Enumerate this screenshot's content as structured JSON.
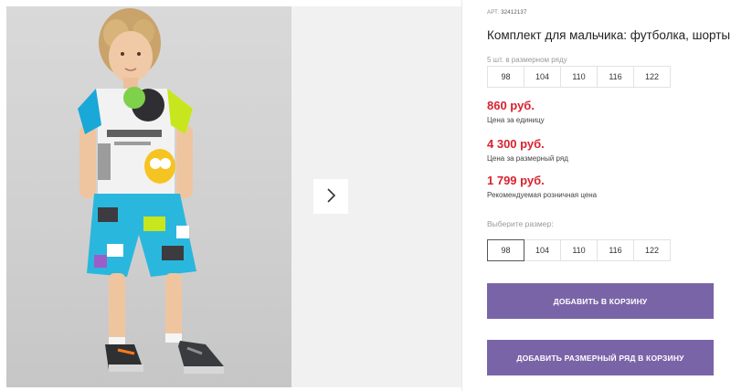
{
  "product": {
    "article_label": "АРТ.",
    "article_value": "32412137",
    "title": "Комплект для мальчика: футболка, шорты"
  },
  "pack": {
    "caption": "5 шт. в размерном ряду",
    "sizes": [
      "98",
      "104",
      "110",
      "116",
      "122"
    ]
  },
  "prices": [
    {
      "value": "860 руб.",
      "label": "Цена за единицу"
    },
    {
      "value": "4 300 руб.",
      "label": "Цена за размерный ряд"
    },
    {
      "value": "1 799 руб.",
      "label": "Рекомендуемая розничная цена"
    }
  ],
  "size_select": {
    "caption": "Выберите размер:",
    "sizes": [
      "98",
      "104",
      "110",
      "116",
      "122"
    ],
    "selected": "98"
  },
  "buttons": {
    "add_to_cart": "ДОБАВИТЬ В КОРЗИНУ",
    "add_pack_to_cart": "ДОБАВИТЬ РАЗМЕРНЫЙ РЯД В КОРЗИНУ"
  },
  "colors": {
    "price": "#d8222f",
    "button": "#7a64a8",
    "shirt_white": "#f2f2f2",
    "shirt_sleeve_lime": "#c8e61e",
    "shirt_sleeve_cyan": "#19a8d8",
    "shorts_cyan": "#2ab7dd"
  },
  "icons": {
    "next": "chevron-right-icon"
  }
}
